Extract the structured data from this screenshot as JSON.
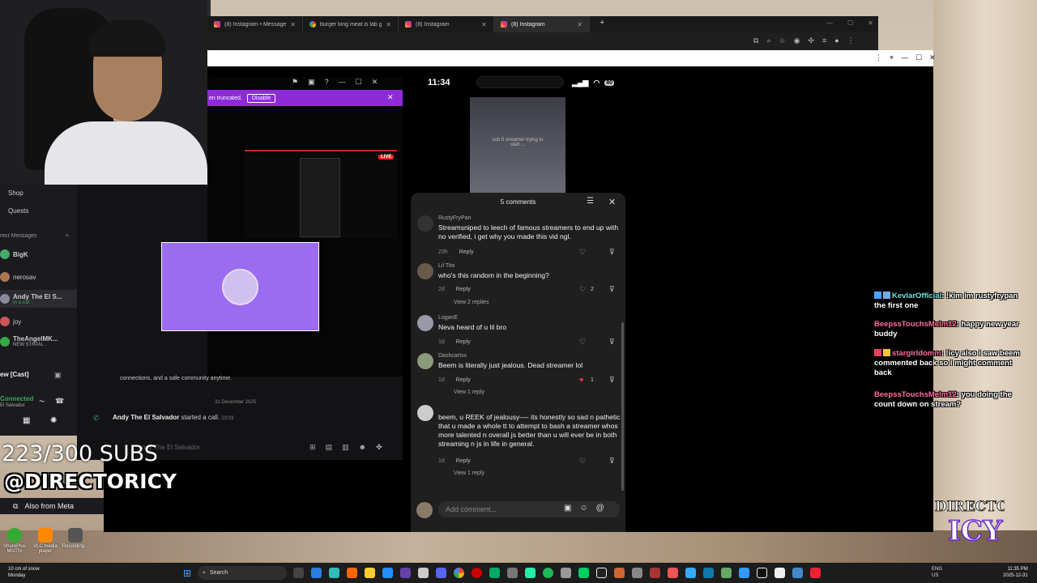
{
  "browser": {
    "tabs": [
      {
        "title": "(8) Instagram • Messages",
        "icon": "instagram-icon"
      },
      {
        "title": "burger king meat is lab grown",
        "icon": "google-icon"
      },
      {
        "title": "(8) Instagram",
        "icon": "instagram-icon"
      },
      {
        "title": "(8) Instagram",
        "icon": "instagram-icon"
      }
    ],
    "new_tab": "+"
  },
  "discord": {
    "sidebar": [
      {
        "label": "Shop"
      },
      {
        "label": "Quests"
      }
    ],
    "dm_header": "rect Messages",
    "dm_add": "+",
    "dms": [
      {
        "name": "BigK",
        "status": ""
      },
      {
        "name": "nerosav",
        "status": ""
      },
      {
        "name": "Andy The El S...",
        "status": "In a call"
      },
      {
        "name": "joy",
        "status": ""
      },
      {
        "name": "TheAngelMK...",
        "status": "NEW STRAN..."
      }
    ],
    "voice_title": "ew [Cast]",
    "voice_status": "Connected",
    "voice_channel": "El Salvador",
    "banner_text": "en truncated.",
    "banner_button": "Disable",
    "live": "LIVE",
    "message_text": "connections, and a safe community anytime.",
    "date_divider": "31 December 2025",
    "call_user": "Andy The El Salvador",
    "call_text": "started a call.",
    "call_time": "23:03",
    "input_placeholder": "ndy The El Salvador"
  },
  "overlay": {
    "subs": "223/300 SUBS",
    "handle": "@DIRECTORICY",
    "meta_item": "Also from Meta"
  },
  "phone": {
    "time": "11:34",
    "battery": "80",
    "video_caption": "sub 5 streamer trying to start ..."
  },
  "comments": {
    "title": "5 comments",
    "items": [
      {
        "user": "RustyFryPan",
        "text": "Streamsniped to leech of famous streamers to end up with no verified, i get why you made this vid ngl.",
        "age": "23h",
        "reply": "Reply",
        "likes": "",
        "view_replies": ""
      },
      {
        "user": "Lil Tito",
        "text": "who's this random in the beginning?",
        "age": "2d",
        "reply": "Reply",
        "likes": "2",
        "view_replies": "View 2 replies"
      },
      {
        "user": "LoganE",
        "text": "Neva heard of u lil bro",
        "age": "1d",
        "reply": "Reply",
        "likes": "",
        "view_replies": ""
      },
      {
        "user": "Dashcartxx",
        "text": "Beem is literally just jealous. Dead streamer lol",
        "age": "1d",
        "reply": "Reply",
        "likes": "1",
        "view_replies": "View 1 reply"
      },
      {
        "user": "",
        "text": "beem, u REEK of jealousy—- its honestly so sad n pathetic that u made a whole tt to attempt to bash a streamer whos more talented n overall js better than u will ever be in both streaming n js in life in general.",
        "age": "1d",
        "reply": "Reply",
        "likes": "",
        "view_replies": "View 1 reply"
      }
    ],
    "add_placeholder": "Add comment..."
  },
  "chat": [
    {
      "user": "KevlarOfficial",
      "text": ": !kim im rustyfrypan the first one",
      "color": "#6fe3df"
    },
    {
      "user": "BeepssTouchsMelm12",
      "text": ": happy new year buddy",
      "color": "#ff6f9a"
    },
    {
      "user": "stargirldomm",
      "text": ": !icy also i saw beem commented back so i might comment back",
      "color": "#ff6f9a"
    },
    {
      "user": "BeepssTouchsMelm12",
      "text": ": you doing the count down on stream?",
      "color": "#ff6f9a"
    }
  ],
  "logo": {
    "line1": "DIRECTOR",
    "line2": "ICY"
  },
  "desktop_icons": [
    {
      "label": "ShurePlus MOTIV"
    },
    {
      "label": "VLC media player"
    },
    {
      "label": "Recording..."
    }
  ],
  "taskbar": {
    "weather_line1": "10 cm of snow",
    "weather_line2": "Monday",
    "search": "Search",
    "lang_line1": "ENG",
    "lang_line2": "US",
    "time": "11:35 PM",
    "date": "2025-12-31"
  }
}
